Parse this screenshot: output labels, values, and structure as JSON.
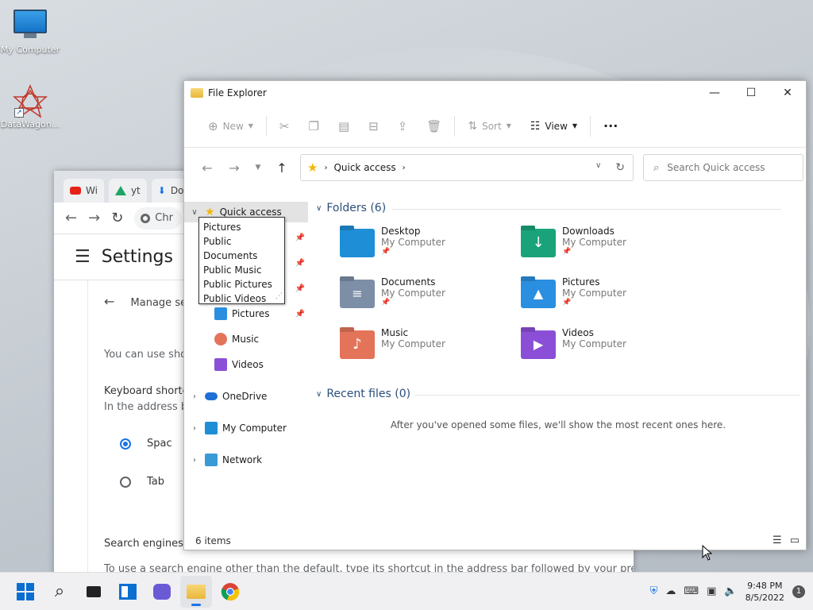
{
  "desktop": {
    "icons": [
      {
        "label": "My Computer"
      },
      {
        "label": "DataWagon..."
      }
    ]
  },
  "chrome": {
    "tabs": [
      {
        "label": "Wi",
        "icon": "youtube-icon"
      },
      {
        "label": "yt",
        "icon": "drive-icon"
      },
      {
        "label": "Do",
        "icon": "download-icon"
      }
    ],
    "omnibox_text": "Chr",
    "settings_title": "Settings",
    "subpage_title": "Manage se",
    "body_line1": "You can use shor",
    "shortcut_label": "Keyboard shortcu",
    "shortcut_desc": "In the address bar",
    "radio1": "Spac",
    "radio2": "Tab",
    "search_engines": "Search engines",
    "search_engines_desc": "To use a search engine other than the default, type its shortcut in the address bar followed by your preferred"
  },
  "explorer": {
    "title": "File Explorer",
    "commands": {
      "new": "New",
      "sort": "Sort",
      "view": "View",
      "more": "···"
    },
    "address": {
      "location": "Quick access",
      "search_placeholder": "Search Quick access"
    },
    "nav": {
      "quick_access": "Quick access",
      "pictures": "Pictures",
      "music": "Music",
      "videos": "Videos",
      "onedrive": "OneDrive",
      "my_computer": "My Computer",
      "network": "Network"
    },
    "tooltip_items": [
      "Pictures",
      "Public Documents",
      "Public Music",
      "Public Pictures",
      "Public Videos"
    ],
    "folders_heading": "Folders (6)",
    "folders": [
      {
        "name": "Desktop",
        "sub": "My Computer",
        "color": "#1e8fd6"
      },
      {
        "name": "Downloads",
        "sub": "My Computer",
        "color": "#1aa37a"
      },
      {
        "name": "Documents",
        "sub": "My Computer",
        "color": "#7d8fa6"
      },
      {
        "name": "Pictures",
        "sub": "My Computer",
        "color": "#2a8fe0"
      },
      {
        "name": "Music",
        "sub": "My Computer",
        "color": "#e3745a"
      },
      {
        "name": "Videos",
        "sub": "My Computer",
        "color": "#8a4fd6"
      }
    ],
    "recent_heading": "Recent files (0)",
    "recent_empty": "After you've opened some files, we'll show the most recent ones here.",
    "status": "6 items"
  },
  "taskbar": {
    "time": "9:48 PM",
    "date": "8/5/2022",
    "notifications": "1"
  }
}
